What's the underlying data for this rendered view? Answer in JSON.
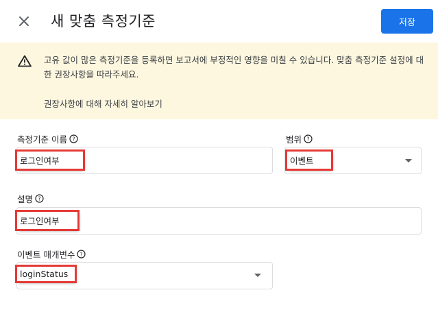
{
  "header": {
    "title": "새 맞춤 측정기준",
    "save_label": "저장",
    "close_icon": "close-icon"
  },
  "warning": {
    "icon": "warning-triangle-icon",
    "text": "고유 값이 많은 측정기준을 등록하면 보고서에 부정적인 영향을 미칠 수 있습니다. 맞춤 측정기준 설정에 대한 권장사항을 따라주세요.",
    "link": "권장사항에 대해 자세히 알아보기",
    "background": "#fef7e0"
  },
  "form": {
    "dimension_name": {
      "label": "측정기준 이름",
      "value": "로그인여부"
    },
    "scope": {
      "label": "범위",
      "value": "이벤트"
    },
    "description": {
      "label": "설명",
      "value": "로그인여부"
    },
    "event_parameter": {
      "label": "이벤트 매개변수",
      "value": "loginStatus"
    }
  },
  "colors": {
    "accent": "#1a73e8",
    "highlight": "#e53935"
  }
}
